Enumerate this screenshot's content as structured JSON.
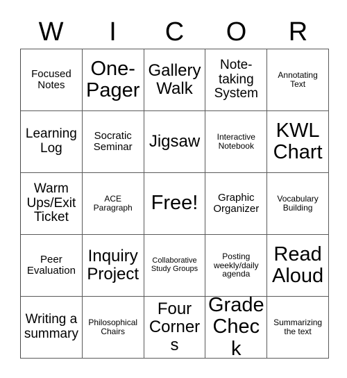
{
  "card": {
    "title_letters": [
      "W",
      "I",
      "C",
      "O",
      "R"
    ],
    "free_space_label": "Free!",
    "rows": [
      [
        {
          "label": "Focused Notes"
        },
        {
          "label": "One-Pager"
        },
        {
          "label": "Gallery Walk"
        },
        {
          "label": "Note-taking System"
        },
        {
          "label": "Annotating Text"
        }
      ],
      [
        {
          "label": "Learning Log"
        },
        {
          "label": "Socratic Seminar"
        },
        {
          "label": "Jigsaw"
        },
        {
          "label": "Interactive Notebook"
        },
        {
          "label": "KWL Chart"
        }
      ],
      [
        {
          "label": "Warm Ups/Exit Ticket"
        },
        {
          "label": "ACE Paragraph"
        },
        {
          "label": "Free!"
        },
        {
          "label": "Graphic Organizer"
        },
        {
          "label": "Vocabulary Building"
        }
      ],
      [
        {
          "label": "Peer Evaluation"
        },
        {
          "label": "Inquiry Project"
        },
        {
          "label": "Collaborative Study Groups"
        },
        {
          "label": "Posting weekly/daily agenda"
        },
        {
          "label": "Read Aloud"
        }
      ],
      [
        {
          "label": "Writing a summary"
        },
        {
          "label": "Philosophical Chairs"
        },
        {
          "label": "Four Corners"
        },
        {
          "label": "Grade Check"
        },
        {
          "label": "Summarizing the text"
        }
      ]
    ],
    "colors": {
      "background": "#ffffff",
      "text": "#000000",
      "border": "#5a5a5a"
    }
  }
}
